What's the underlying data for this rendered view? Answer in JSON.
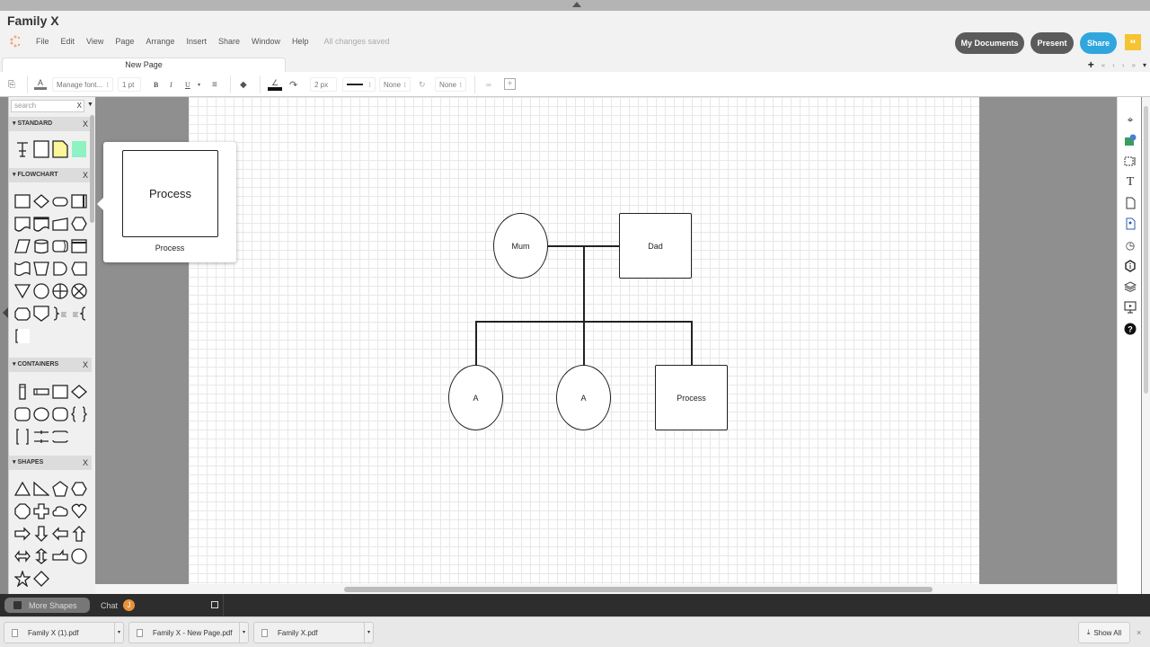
{
  "window": {
    "title": "Family X"
  },
  "menu": {
    "items": [
      "File",
      "Edit",
      "View",
      "Page",
      "Arrange",
      "Insert",
      "Share",
      "Window",
      "Help"
    ],
    "status": "All changes saved"
  },
  "header_buttons": {
    "my_documents": "My Documents",
    "present": "Present",
    "share": "Share",
    "comments_icon": "quote-icon"
  },
  "colors": {
    "share": "#2fa6de",
    "dark_button": "#5b5b5b",
    "comment_badge": "#f5c431",
    "chat_avatar": "#e8933b"
  },
  "tabs": {
    "page_tab": "New Page",
    "add": "+",
    "nav": [
      "«",
      "‹",
      "›",
      "»"
    ],
    "dropdown": "▾"
  },
  "toolbar": {
    "font": "Manage font...",
    "font_size": "1 pt",
    "bold": "B",
    "italic": "I",
    "underline": "U",
    "line_width": "2 px",
    "arrow_start": "None",
    "arrow_end": "None"
  },
  "left_panel": {
    "search_placeholder": "search",
    "sections": [
      {
        "title": "STANDARD",
        "close": "X"
      },
      {
        "title": "FLOWCHART",
        "close": "X"
      },
      {
        "title": "CONTAINERS",
        "close": "X"
      },
      {
        "title": "SHAPES",
        "close": "X"
      }
    ]
  },
  "popover": {
    "shape_label": "Process",
    "caption": "Process"
  },
  "diagram": {
    "nodes": [
      {
        "id": "mum",
        "label": "Mum",
        "shape": "circle"
      },
      {
        "id": "dad",
        "label": "Dad",
        "shape": "rect"
      },
      {
        "id": "child1",
        "label": "A",
        "shape": "circle"
      },
      {
        "id": "child2",
        "label": "A",
        "shape": "circle"
      },
      {
        "id": "child3",
        "label": "Process",
        "shape": "rect"
      }
    ],
    "edges": [
      {
        "from": "mum",
        "to": "dad"
      },
      {
        "from": "mum-dad",
        "to": "child1"
      },
      {
        "from": "mum-dad",
        "to": "child2"
      },
      {
        "from": "mum-dad",
        "to": "child3"
      }
    ]
  },
  "bottom_bar": {
    "more_shapes": "More Shapes",
    "chat": "Chat",
    "chat_avatar": "J"
  },
  "downloads": {
    "files": [
      "Family X (1).pdf",
      "Family X - New Page.pdf",
      "Family X.pdf"
    ],
    "show_all": "Show All",
    "close": "×"
  }
}
